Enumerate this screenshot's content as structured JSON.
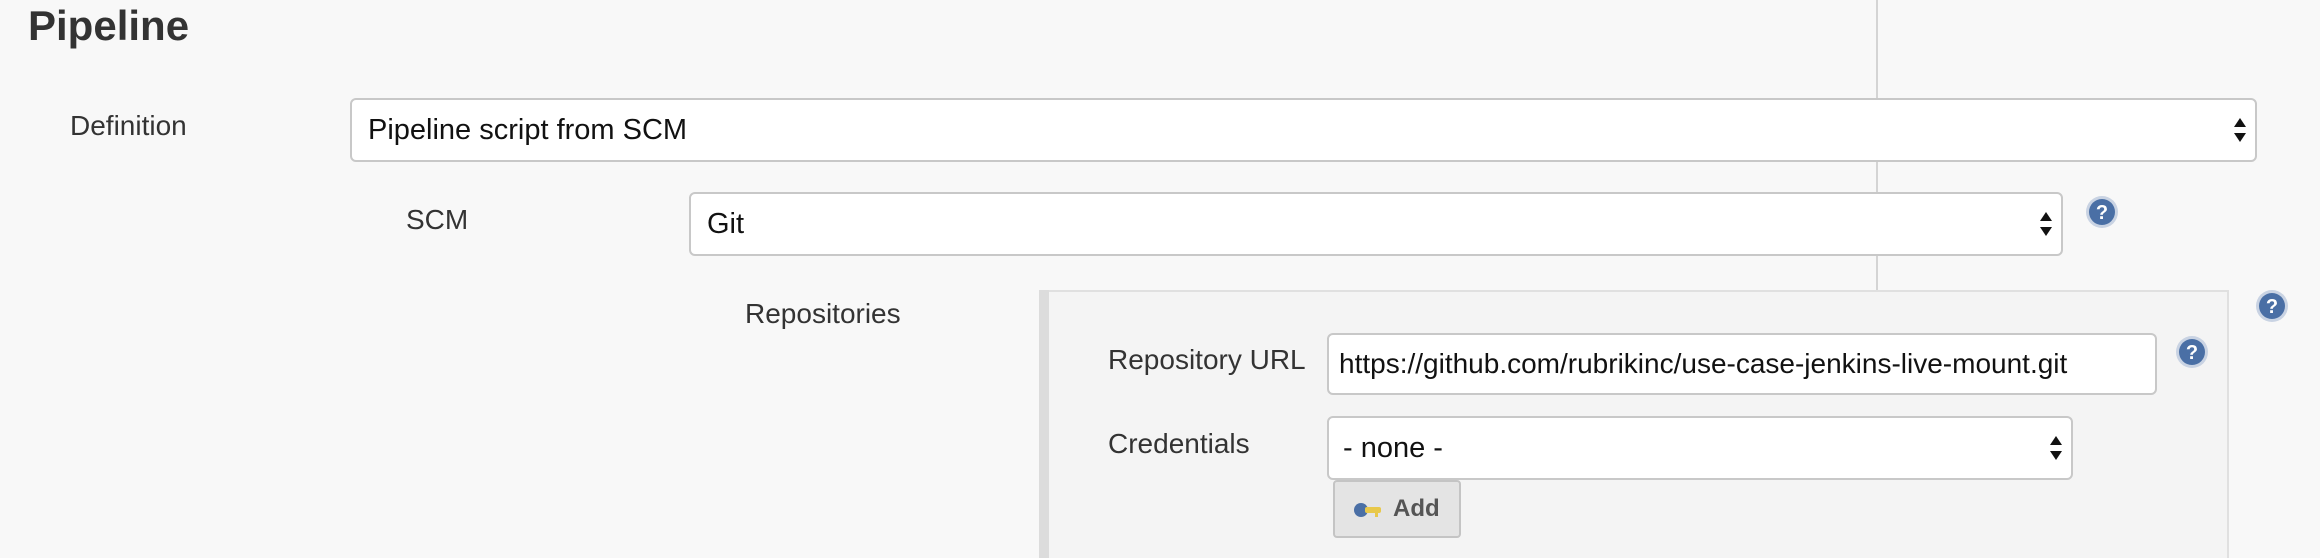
{
  "section": {
    "title": "Pipeline"
  },
  "definition": {
    "label": "Definition",
    "selected": "Pipeline script from SCM"
  },
  "scm": {
    "label": "SCM",
    "selected": "Git"
  },
  "repositories": {
    "label": "Repositories",
    "repository_url": {
      "label": "Repository URL",
      "value": "https://github.com/rubrikinc/use-case-jenkins-live-mount.git"
    },
    "credentials": {
      "label": "Credentials",
      "selected": "- none -"
    },
    "add_button_label": "Add"
  },
  "icons": {
    "help": "help-icon",
    "key": "key-icon",
    "select_arrows": "up-down-arrows-icon"
  },
  "colors": {
    "help_icon": "#4a6fa5",
    "background": "#f8f8f8"
  }
}
